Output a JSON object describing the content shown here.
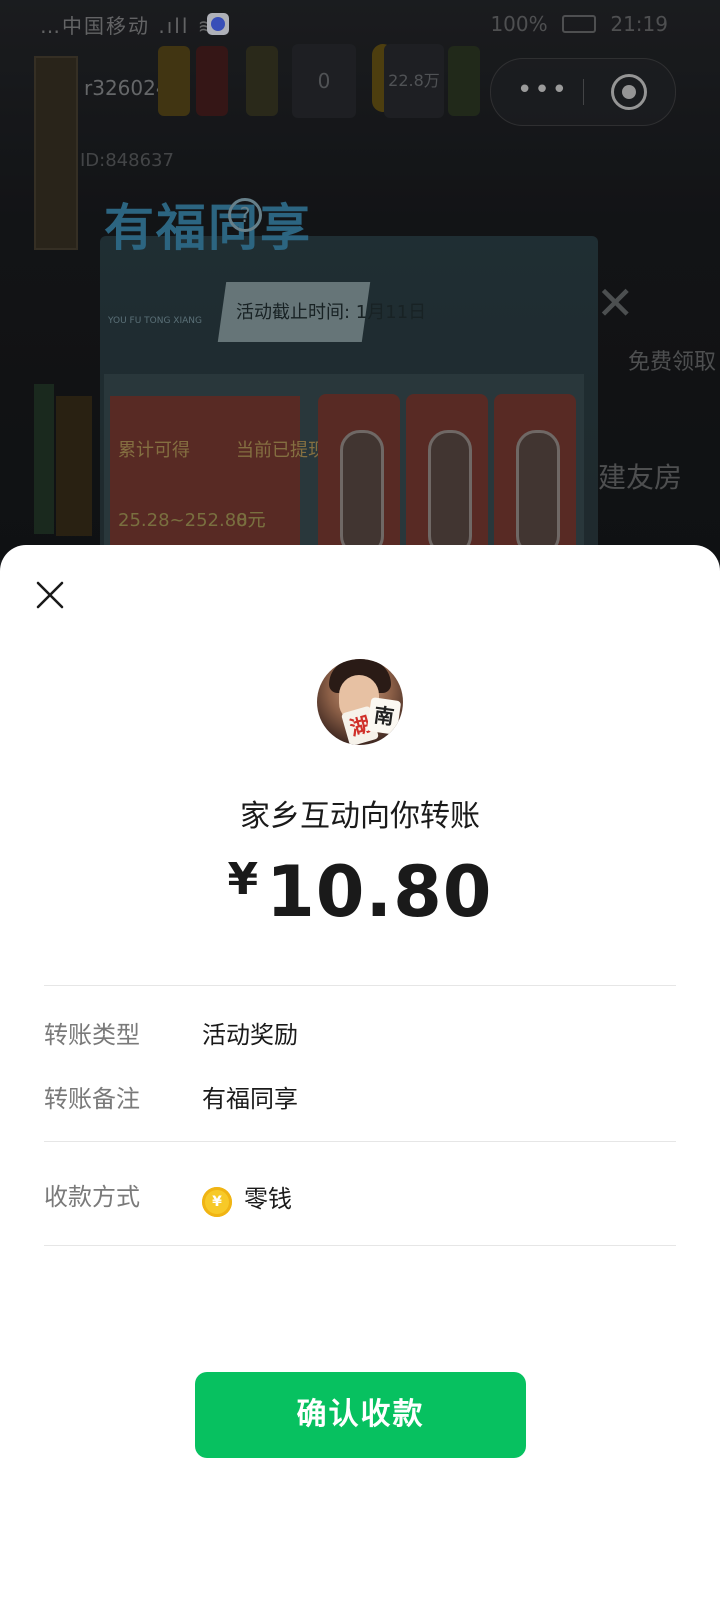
{
  "status_bar": {
    "left_text": "…中国移动 .ıll ≋",
    "battery": "100%",
    "time": "21:19"
  },
  "mini_program_capsule": {
    "more_icon": "more-dots-icon",
    "close_icon": "target-circle-icon"
  },
  "game_background": {
    "username": "r​326024...",
    "user_id": "ID:848637",
    "stat_values": [
      "0",
      "22.8万"
    ],
    "panel_title": "有福同享",
    "panel_pinyin": "YOU FU TONG XIANG",
    "deadline": "活动截止时间: 1月11日",
    "reward_labels": [
      "累计可得",
      "当前已提现",
      "25.28~252.88元",
      "0元"
    ],
    "side_labels": [
      "免费领取",
      "建友房"
    ]
  },
  "sheet": {
    "title": "家乡互动向你转账",
    "amount_currency": "¥",
    "amount_value": "10.80",
    "details": [
      {
        "label": "转账类型",
        "value": "活动奖励"
      },
      {
        "label": "转账备注",
        "value": "有福同享"
      }
    ],
    "payment_method": {
      "label": "收款方式",
      "value": "零钱",
      "icon": "coin-icon",
      "icon_glyph": "¥"
    },
    "confirm_label": "确认收款",
    "avatar_tiles": [
      "湖",
      "南"
    ]
  },
  "colors": {
    "accent_green": "#07c160",
    "coin_yellow": "#f7c928",
    "label_gray": "#7a7a7a",
    "text_dark": "#1a1a1a"
  }
}
